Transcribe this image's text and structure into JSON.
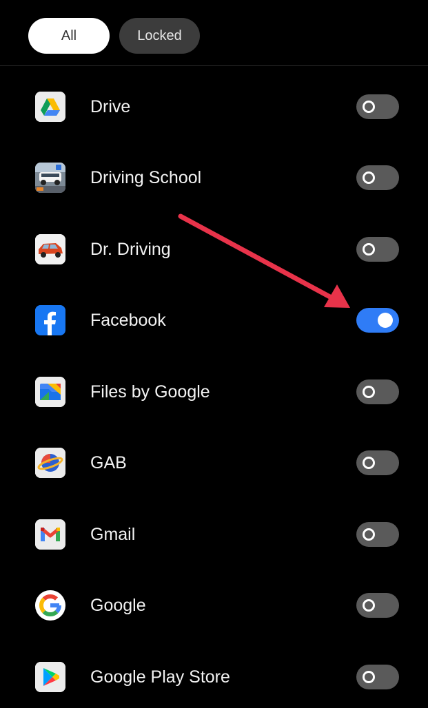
{
  "tabs": [
    {
      "label": "All",
      "selected": true
    },
    {
      "label": "Locked",
      "selected": false
    }
  ],
  "apps": [
    {
      "name": "Drive",
      "icon": "google-drive-icon",
      "locked": false
    },
    {
      "name": "Driving School",
      "icon": "driving-school-icon",
      "locked": false
    },
    {
      "name": "Dr. Driving",
      "icon": "dr-driving-icon",
      "locked": false
    },
    {
      "name": "Facebook",
      "icon": "facebook-icon",
      "locked": true
    },
    {
      "name": "Files by Google",
      "icon": "files-by-google-icon",
      "locked": false
    },
    {
      "name": "GAB",
      "icon": "gab-icon",
      "locked": false
    },
    {
      "name": "Gmail",
      "icon": "gmail-icon",
      "locked": false
    },
    {
      "name": "Google",
      "icon": "google-icon",
      "locked": false
    },
    {
      "name": "Google Play Store",
      "icon": "google-play-store-icon",
      "locked": false
    }
  ],
  "annotation": {
    "type": "arrow",
    "color": "#e8334a",
    "target": "Facebook toggle"
  },
  "colors": {
    "background": "#000000",
    "toggle_on": "#2f7cf6",
    "toggle_off": "#5a5a5a",
    "tab_selected_bg": "#ffffff",
    "tab_unselected_bg": "#3c3c3c"
  }
}
